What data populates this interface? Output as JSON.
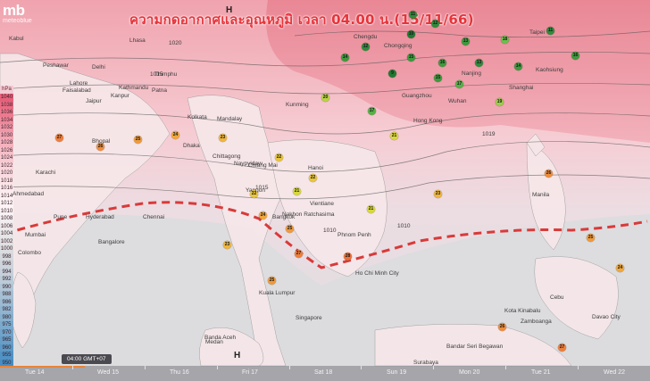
{
  "brand": {
    "logo": "mb",
    "tagline": "meteoblue"
  },
  "title": "ความกดอากาศและอุณหภูมิ เวลา 04.00 น.(15/11/66)",
  "legend": {
    "unit": "hPa",
    "levels": [
      "1040",
      "1038",
      "1036",
      "1034",
      "1032",
      "1030",
      "1028",
      "1026",
      "1024",
      "1022",
      "1020",
      "1018",
      "1016",
      "1014",
      "1012",
      "1010",
      "1008",
      "1006",
      "1004",
      "1002",
      "1000",
      "998",
      "996",
      "994",
      "992",
      "990",
      "988",
      "986",
      "982",
      "980",
      "975",
      "970",
      "965",
      "960",
      "955",
      "950"
    ],
    "colors": [
      "#e7607a",
      "#ea6c84",
      "#ec7a8f",
      "#ee889b",
      "#f097a8",
      "#f2a6b4",
      "#f4b2be",
      "#f6bec8",
      "#f8c9d1",
      "#f9d3da",
      "#fadbe1",
      "#fbe3e7",
      "#fcebee",
      "#fdf1f3",
      "#fdf4f5",
      "#f8f2f4",
      "#f1ecef",
      "#ebe8ea",
      "#e6e5e7",
      "#e0e0e2",
      "#dadcdf",
      "#d3d8dd",
      "#cdd4db",
      "#c5d0da",
      "#bbcbd8",
      "#b0c5d6",
      "#a5bfd4",
      "#9bbad2",
      "#90b4d0",
      "#86afce",
      "#7ba9cc",
      "#70a3ca",
      "#669ec8",
      "#5b98c6",
      "#5192c4",
      "#468dc2"
    ]
  },
  "isobar_labels": [
    "1020",
    "1015",
    "1019",
    "1015",
    "1010",
    "1010"
  ],
  "pressure_centers": [
    "H",
    "H"
  ],
  "place_labels": [
    "Kabul",
    "Peshawar",
    "Lahore",
    "Faisalabad",
    "Delhi",
    "Jaipur",
    "Kanpur",
    "Patna",
    "Karachi",
    "Ahmedabad",
    "Bhopal",
    "Kolkata",
    "Mumbai",
    "Pune",
    "Hyderabad",
    "Chennai",
    "Bangalore",
    "Colombo",
    "Dhaka",
    "Chittagong",
    "Mandalay",
    "Yangon",
    "Naypyidaw",
    "Chiang Mai",
    "Bangkok",
    "Vientiane",
    "Hanoi",
    "Phnom Penh",
    "Ho Chi Minh City",
    "Nakhon Ratchasima",
    "Kuala Lumpur",
    "Medan",
    "Singapore",
    "Kota Kinabalu",
    "Manila",
    "Cebu",
    "Davao City",
    "Bandar Seri Begawan",
    "Guangzhou",
    "Hong Kong",
    "Kunming",
    "Chongqing",
    "Chengdu",
    "Wuhan",
    "Taipei",
    "Kaohsiung",
    "Shanghai",
    "Nanjing",
    "Lhasa",
    "Kathmandu",
    "Thimphu",
    "Zamboanga",
    "Surabaya",
    "Banda Aceh"
  ],
  "stations": [
    {
      "v": "11",
      "c": "#2e8b3a"
    },
    {
      "v": "12",
      "c": "#2e8b3a"
    },
    {
      "v": "13",
      "c": "#3c9a3c"
    },
    {
      "v": "18",
      "c": "#6cc04a"
    },
    {
      "v": "11",
      "c": "#2e8b3a"
    },
    {
      "v": "16",
      "c": "#3c9a3c"
    },
    {
      "v": "15",
      "c": "#3c9a3c"
    },
    {
      "v": "16",
      "c": "#3c9a3c"
    },
    {
      "v": "13",
      "c": "#2e8b3a"
    },
    {
      "v": "14",
      "c": "#3c9a3c"
    },
    {
      "v": "15",
      "c": "#3c9a3c"
    },
    {
      "v": "17",
      "c": "#55b046"
    },
    {
      "v": "19",
      "c": "#9ccc4a"
    },
    {
      "v": "21",
      "c": "#d8d83a"
    },
    {
      "v": "22",
      "c": "#e8c53a"
    },
    {
      "v": "23",
      "c": "#efb53a"
    },
    {
      "v": "24",
      "c": "#f0a83a"
    },
    {
      "v": "25",
      "c": "#ef9a3a"
    },
    {
      "v": "26",
      "c": "#ee8c3a"
    },
    {
      "v": "27",
      "c": "#ed7e3a"
    },
    {
      "v": "22",
      "c": "#e8c53a"
    },
    {
      "v": "24",
      "c": "#f0a83a"
    },
    {
      "v": "25",
      "c": "#ef9a3a"
    },
    {
      "v": "27",
      "c": "#ed7e3a"
    },
    {
      "v": "28",
      "c": "#ec703a"
    },
    {
      "v": "21",
      "c": "#d8d83a"
    },
    {
      "v": "23",
      "c": "#efb53a"
    },
    {
      "v": "26",
      "c": "#ee8c3a"
    },
    {
      "v": "25",
      "c": "#ef9a3a"
    },
    {
      "v": "24",
      "c": "#f0a83a"
    },
    {
      "v": "12",
      "c": "#2e8b3a"
    },
    {
      "v": "9",
      "c": "#1e7a32"
    },
    {
      "v": "10",
      "c": "#1e7a32"
    },
    {
      "v": "14",
      "c": "#3c9a3c"
    },
    {
      "v": "17",
      "c": "#55b046"
    },
    {
      "v": "20",
      "c": "#b8d440"
    },
    {
      "v": "21",
      "c": "#d8d83a"
    },
    {
      "v": "22",
      "c": "#e8c53a"
    },
    {
      "v": "23",
      "c": "#efb53a"
    },
    {
      "v": "25",
      "c": "#ef9a3a"
    },
    {
      "v": "26",
      "c": "#ee8c3a"
    },
    {
      "v": "27",
      "c": "#ed7e3a"
    }
  ],
  "timebar": {
    "current_time": "04:00 GMT+07",
    "days": [
      "Tue 14",
      "Wed 15",
      "Thu 16",
      "Fri 17",
      "Sat 18",
      "Sun 19",
      "Mon 20",
      "Tue 21",
      "Wed 22"
    ],
    "progress": 0.13
  }
}
